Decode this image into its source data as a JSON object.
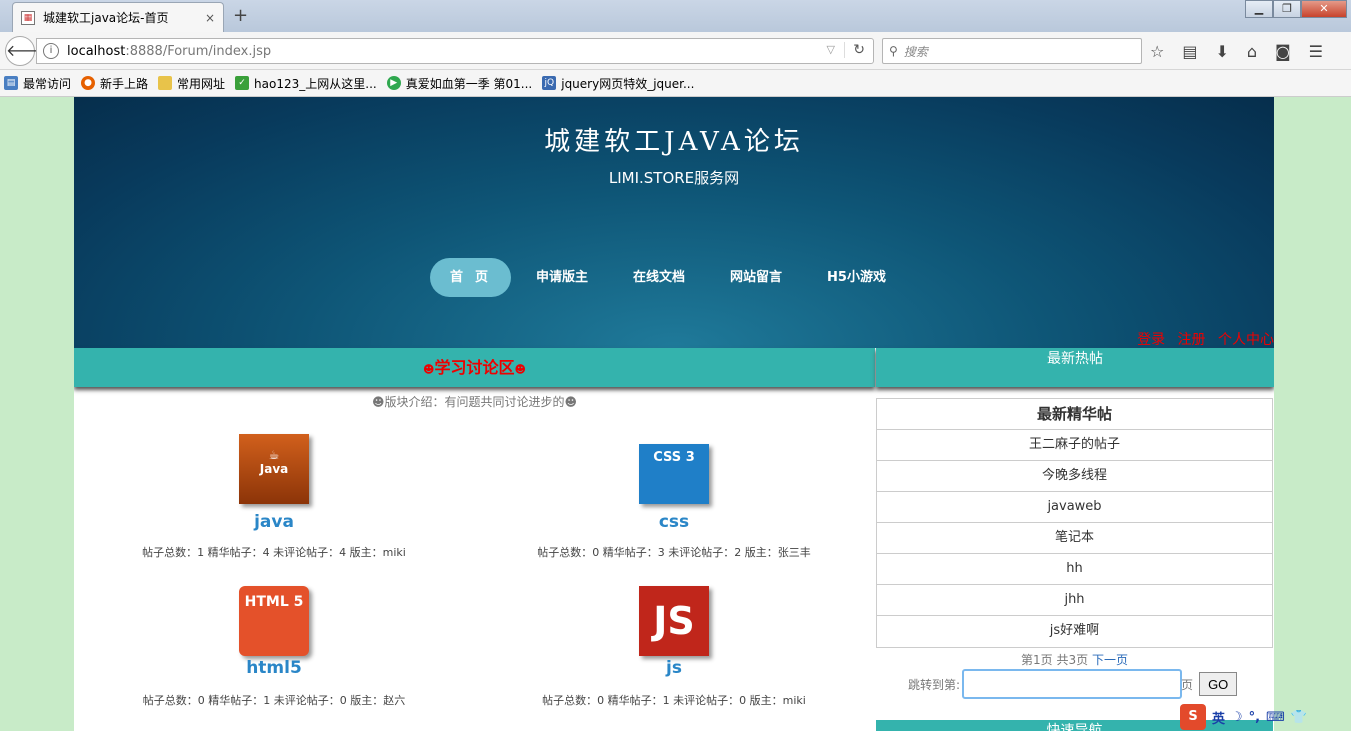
{
  "browser": {
    "tab_title": "城建软工java论坛-首页",
    "tab_close": "×",
    "new_tab": "+",
    "url_host": "localhost",
    "url_path": ":8888/Forum/index.jsp",
    "search_placeholder": "搜索",
    "win_min": "▁",
    "win_max": "❐",
    "win_close": "✕"
  },
  "bookmarks": [
    {
      "label": "最常访问",
      "icon": "most-visited-icon",
      "color": "#4a7fc2"
    },
    {
      "label": "新手上路",
      "icon": "firefox-icon",
      "color": "#e66000"
    },
    {
      "label": "常用网址",
      "icon": "folder-icon",
      "color": "#e8c34a"
    },
    {
      "label": "hao123_上网从这里...",
      "icon": "hao123-icon",
      "color": "#3aa03a"
    },
    {
      "label": "真爱如血第一季 第01...",
      "icon": "play-icon",
      "color": "#2fa84f"
    },
    {
      "label": "jquery网页特效_jquer...",
      "icon": "jq-icon",
      "color": "#3a6ab0"
    }
  ],
  "site": {
    "title": "城建软工JAVA论坛",
    "subtitle": "LIMI.STORE服务网",
    "nav": [
      "首页",
      "申请版主",
      "在线文档",
      "网站留言",
      "H5小游戏"
    ],
    "user_links": [
      "登录",
      "注册",
      "个人中心"
    ]
  },
  "left": {
    "header": "学习讨论区",
    "header_dot": "☻",
    "intro": "☻版块介绍：有问题共同讨论进步的☻",
    "boards": [
      {
        "name": "java",
        "logo_text": "Java",
        "logo_color": "#b84a10",
        "stats": "帖子总数：1 精华帖子：4 未评论帖子：4 版主：miki"
      },
      {
        "name": "css",
        "logo_text": "CSS 3",
        "logo_color": "#1f7fc8",
        "stats": "帖子总数：0 精华帖子：3 未评论帖子：2 版主：张三丰"
      },
      {
        "name": "html5",
        "logo_text": "HTML 5",
        "logo_color": "#e4512a",
        "stats": "帖子总数：0 精华帖子：1 未评论帖子：0 版主：赵六"
      },
      {
        "name": "js",
        "logo_text": "JS",
        "logo_color": "#c0261b",
        "stats": "帖子总数：0 精华帖子：1 未评论帖子：0 版主：miki"
      }
    ]
  },
  "right": {
    "header": "最新热帖",
    "list_title": "最新精华帖",
    "posts": [
      "王二麻子的帖子",
      "今晚多线程",
      "javaweb",
      "笔记本",
      "hh",
      "jhh",
      "js好难啊"
    ],
    "pager_info": "第1页 共3页",
    "pager_next": "下一页",
    "jump_label": "跳转到第:",
    "jump_suffix": "页",
    "go_label": "GO",
    "next_section": "快速导航"
  },
  "ime": {
    "mode": "英"
  }
}
